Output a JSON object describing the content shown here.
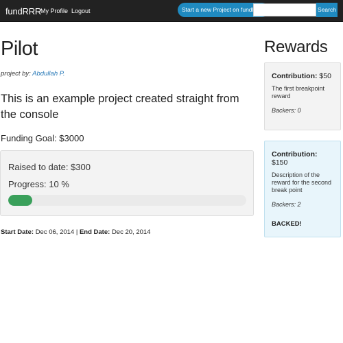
{
  "navbar": {
    "brand": "fundRRR",
    "my_profile": "My Profile",
    "logout": "Logout",
    "new_project_button": "Start a new Project on fundRRR",
    "search_value": "",
    "search_button": "Search"
  },
  "project": {
    "title": "Pilot",
    "byline_prefix": "project by:",
    "author": "Abdullah P.",
    "description": "This is an example project created straight from the console",
    "funding_goal": "Funding Goal: $3000",
    "raised": "Raised to date: $300",
    "progress_label": "Progress: 10 %",
    "progress_fraction": 0.1,
    "start_date_label": "Start Date:",
    "start_date": "Dec 06, 2014",
    "separator": "|",
    "end_date_label": "End Date:",
    "end_date": "Dec 20, 2014"
  },
  "rewards": {
    "heading": "Rewards",
    "items": [
      {
        "contribution_label": "Contribution:",
        "contribution_amount": "$50",
        "description": "The first breakpoint reward",
        "backers": "Backers: 0",
        "status": ""
      },
      {
        "contribution_label": "Contribution:",
        "contribution_amount": "$150",
        "description": "Description of the reward for the second break point",
        "backers": "Backers: 2",
        "status": "BACKED!"
      }
    ]
  },
  "colors": {
    "navbar_bg": "#222222",
    "accent_blue": "#1f8ac0",
    "progress_green": "#3aa05b",
    "backed_card_bg": "#e8f5fb"
  }
}
